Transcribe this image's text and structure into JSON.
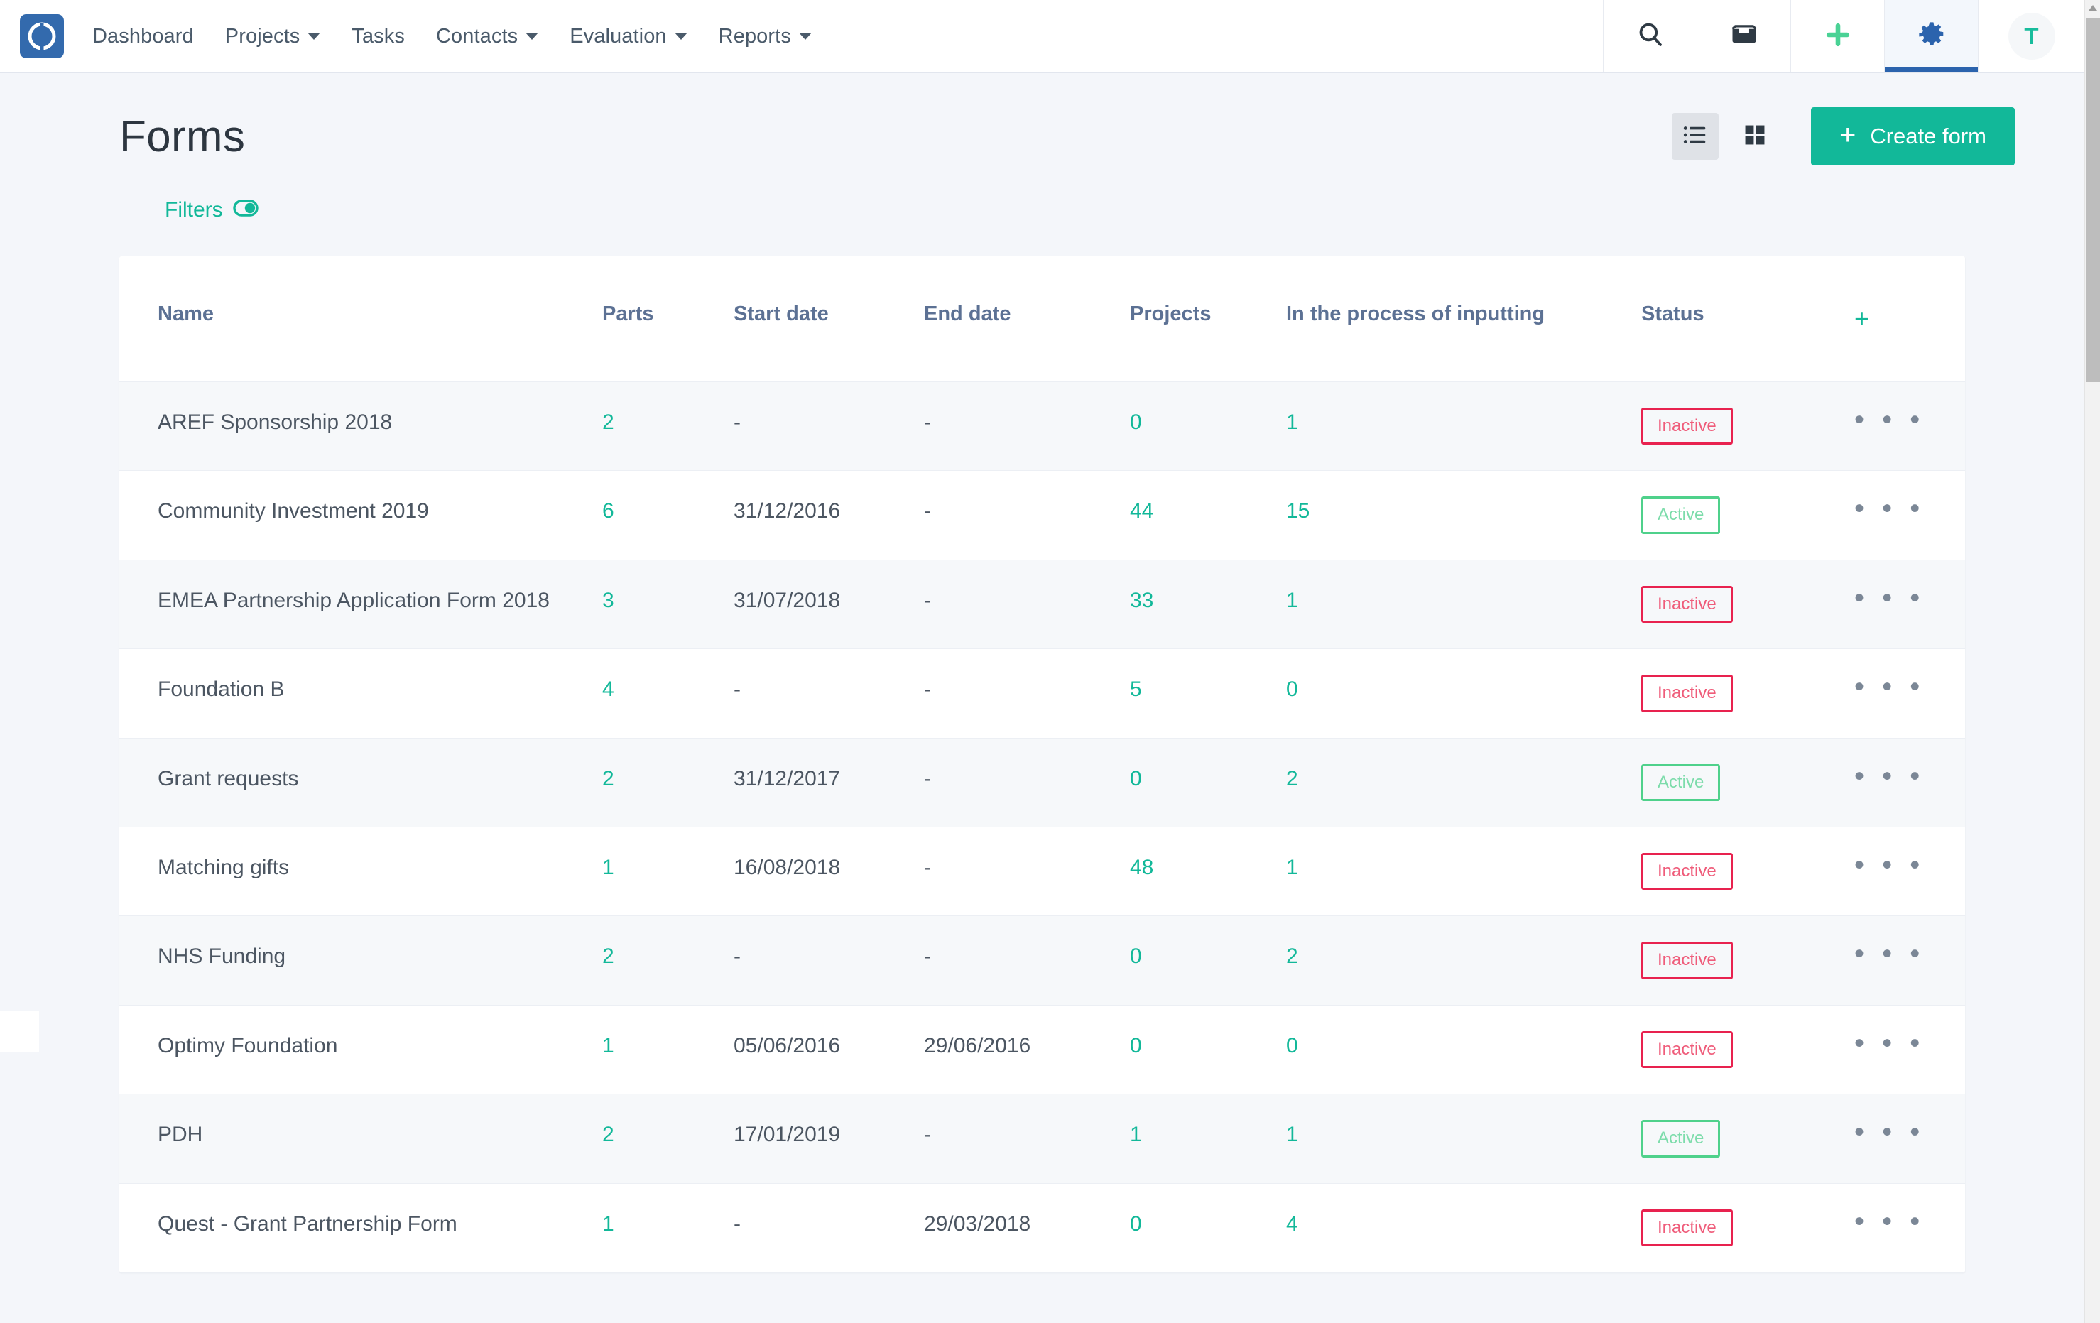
{
  "navbar": {
    "logo_icon": "optimy-ring-logo",
    "links": [
      {
        "label": "Dashboard",
        "has_caret": false
      },
      {
        "label": "Projects",
        "has_caret": true
      },
      {
        "label": "Tasks",
        "has_caret": false
      },
      {
        "label": "Contacts",
        "has_caret": true
      },
      {
        "label": "Evaluation",
        "has_caret": true
      },
      {
        "label": "Reports",
        "has_caret": true
      }
    ],
    "icons": [
      {
        "name": "search-icon",
        "active": false
      },
      {
        "name": "inbox-icon",
        "active": false
      },
      {
        "name": "plus-icon",
        "active": false
      },
      {
        "name": "gear-icon",
        "active": true
      }
    ],
    "avatar_initial": "T",
    "colors": {
      "logo_bg": "#336aad",
      "active_underline": "#2b63ad",
      "plus_icon": "#4ad295",
      "gear_icon": "#2b63ad",
      "avatar_text": "#18bc9c"
    }
  },
  "page": {
    "title": "Forms",
    "filters_label": "Filters",
    "filters_icon": "toggle-switch-icon",
    "view_list_icon": "list-view-icon",
    "view_grid_icon": "grid-view-icon",
    "active_view": "list",
    "create_button_label": "Create form",
    "create_button_plus": "+",
    "accent_green": "#12b899",
    "inactive_red": "#e8224f",
    "active_green": "#4fd18b"
  },
  "table": {
    "columns": [
      "Name",
      "Parts",
      "Start date",
      "End date",
      "Projects",
      "In the process of inputting",
      "Status",
      "+"
    ],
    "add_column_icon": "plus-icon",
    "row_menu_icon": "ellipsis-icon",
    "rows": [
      {
        "name": "AREF Sponsorship 2018",
        "parts": "2",
        "start_date": "-",
        "end_date": "-",
        "projects": "0",
        "in_process": "1",
        "status": "Inactive",
        "menu": "• • •"
      },
      {
        "name": "Community Investment 2019",
        "parts": "6",
        "start_date": "31/12/2016",
        "end_date": "-",
        "projects": "44",
        "in_process": "15",
        "status": "Active",
        "menu": "• • •"
      },
      {
        "name": "EMEA Partnership Application Form 2018",
        "parts": "3",
        "start_date": "31/07/2018",
        "end_date": "-",
        "projects": "33",
        "in_process": "1",
        "status": "Inactive",
        "menu": "• • •"
      },
      {
        "name": "Foundation B",
        "parts": "4",
        "start_date": "-",
        "end_date": "-",
        "projects": "5",
        "in_process": "0",
        "status": "Inactive",
        "menu": "• • •"
      },
      {
        "name": "Grant requests",
        "parts": "2",
        "start_date": "31/12/2017",
        "end_date": "-",
        "projects": "0",
        "in_process": "2",
        "status": "Active",
        "menu": "• • •"
      },
      {
        "name": "Matching gifts",
        "parts": "1",
        "start_date": "16/08/2018",
        "end_date": "-",
        "projects": "48",
        "in_process": "1",
        "status": "Inactive",
        "menu": "• • •"
      },
      {
        "name": "NHS Funding",
        "parts": "2",
        "start_date": "-",
        "end_date": "-",
        "projects": "0",
        "in_process": "2",
        "status": "Inactive",
        "menu": "• • •"
      },
      {
        "name": "Optimy Foundation",
        "parts": "1",
        "start_date": "05/06/2016",
        "end_date": "29/06/2016",
        "projects": "0",
        "in_process": "0",
        "status": "Inactive",
        "menu": "• • •"
      },
      {
        "name": "PDH",
        "parts": "2",
        "start_date": "17/01/2019",
        "end_date": "-",
        "projects": "1",
        "in_process": "1",
        "status": "Active",
        "menu": "• • •"
      },
      {
        "name": "Quest - Grant Partnership Form",
        "parts": "1",
        "start_date": "-",
        "end_date": "29/03/2018",
        "projects": "0",
        "in_process": "4",
        "status": "Inactive",
        "menu": "• • •"
      }
    ]
  },
  "scrollbar": {
    "up_arrow_icon": "triangle-up-icon",
    "thumb_name": "scroll-thumb"
  }
}
